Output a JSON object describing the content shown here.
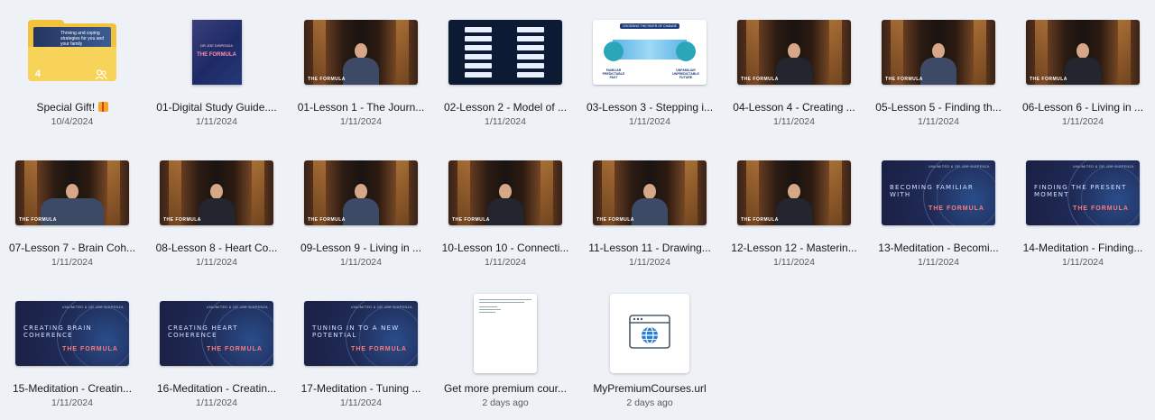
{
  "items": [
    {
      "name": "Special Gift! ",
      "date": "10/4/2024",
      "type": "folder",
      "folder_count": "4",
      "folder_preview_text": "Thriving and coping strategies for you and your family"
    },
    {
      "name": "01-Digital Study Guide....",
      "date": "1/11/2024",
      "type": "pdf",
      "cover_small": "DR JOE DISPENZA",
      "cover_title": "THE FORMULA"
    },
    {
      "name": "01-Lesson 1 - The Journ...",
      "date": "1/11/2024",
      "type": "video"
    },
    {
      "name": "02-Lesson 2 - Model of ...",
      "date": "1/11/2024",
      "type": "diagram1"
    },
    {
      "name": "03-Lesson 3 - Stepping i...",
      "date": "1/11/2024",
      "type": "diagram2",
      "diagram_title": "CROSSING THE RIVER OF CHANGE",
      "left_label": "FAMILIAR PREDICTABLE PAST",
      "right_label": "UNFAMILIAR UNPREDICTABLE FUTURE"
    },
    {
      "name": "04-Lesson 4 - Creating ...",
      "date": "1/11/2024",
      "type": "video"
    },
    {
      "name": "05-Lesson 5 - Finding th...",
      "date": "1/11/2024",
      "type": "video"
    },
    {
      "name": "06-Lesson 6 - Living in ...",
      "date": "1/11/2024",
      "type": "video"
    },
    {
      "name": "07-Lesson 7 - Brain Coh...",
      "date": "1/11/2024",
      "type": "video"
    },
    {
      "name": "08-Lesson 8 - Heart Co...",
      "date": "1/11/2024",
      "type": "video"
    },
    {
      "name": "09-Lesson 9 - Living in ...",
      "date": "1/11/2024",
      "type": "video"
    },
    {
      "name": "10-Lesson 10 - Connecti...",
      "date": "1/11/2024",
      "type": "video"
    },
    {
      "name": "11-Lesson 11 - Drawing...",
      "date": "1/11/2024",
      "type": "video"
    },
    {
      "name": "12-Lesson 12 - Masterin...",
      "date": "1/11/2024",
      "type": "video"
    },
    {
      "name": "13-Meditation - Becomi...",
      "date": "1/11/2024",
      "type": "meditation",
      "thumb_title": "BECOMING FAMILIAR WITH",
      "brand": "THE FORMULA",
      "top_label": "UNLIMITED & DR JOE DISPENZA"
    },
    {
      "name": "14-Meditation - Finding...",
      "date": "1/11/2024",
      "type": "meditation",
      "thumb_title": "FINDING THE PRESENT MOMENT",
      "brand": "THE FORMULA",
      "top_label": "UNLIMITED & DR JOE DISPENZA"
    },
    {
      "name": "15-Meditation - Creatin...",
      "date": "1/11/2024",
      "type": "meditation",
      "thumb_title": "CREATING BRAIN COHERENCE",
      "brand": "THE FORMULA",
      "top_label": "UNLIMITED & DR JOE DISPENZA"
    },
    {
      "name": "16-Meditation - Creatin...",
      "date": "1/11/2024",
      "type": "meditation",
      "thumb_title": "CREATING HEART COHERENCE",
      "brand": "THE FORMULA",
      "top_label": "UNLIMITED & DR JOE DISPENZA"
    },
    {
      "name": "17-Meditation - Tuning ...",
      "date": "1/11/2024",
      "type": "meditation",
      "thumb_title": "TUNING IN TO A NEW POTENTIAL",
      "brand": "THE FORMULA",
      "top_label": "UNLIMITED & DR JOE DISPENZA"
    },
    {
      "name": "Get more premium cour...",
      "date": "2 days ago",
      "type": "text"
    },
    {
      "name": "MyPremiumCourses.url",
      "date": "2 days ago",
      "type": "url"
    }
  ],
  "video_logo": "THE FORMULA",
  "colors": {
    "background": "#eef1f5",
    "folder": "#f2c23a",
    "url_icon": "#2a7fd4"
  }
}
